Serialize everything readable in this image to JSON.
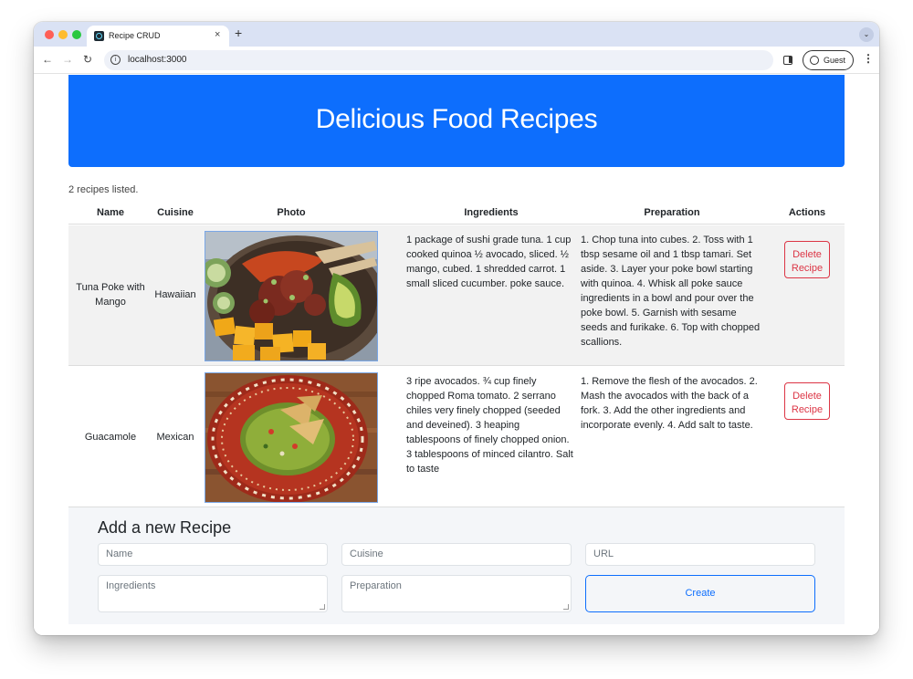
{
  "browser": {
    "tab_title": "Recipe CRUD",
    "tab_close": "×",
    "new_tab": "+",
    "tab_menu": "⌄",
    "url": "localhost:3000",
    "profile_label": "Guest"
  },
  "header": {
    "title": "Delicious Food Recipes"
  },
  "recipes_count_text": "2 recipes listed.",
  "table": {
    "columns": [
      "Name",
      "Cuisine",
      "Photo",
      "Ingredients",
      "Preparation",
      "Actions"
    ],
    "rows": [
      {
        "name": "Tuna Poke with Mango",
        "cuisine": "Hawaiian",
        "ingredients": "1 package of sushi grade tuna. 1 cup cooked quinoa ½ avocado, sliced. ½ mango, cubed. 1 shredded carrot. 1 small sliced cucumber. poke sauce.",
        "preparation": "1. Chop tuna into cubes. 2. Toss with 1 tbsp sesame oil and 1 tbsp tamari. Set aside. 3. Layer your poke bowl starting with quinoa. 4. Whisk all poke sauce ingredients in a bowl and pour over the poke bowl. 5. Garnish with sesame seeds and furikake. 6. Top with chopped scallions.",
        "action_label": "Delete Recipe"
      },
      {
        "name": "Guacamole",
        "cuisine": "Mexican",
        "ingredients": "3 ripe avocados. ¾ cup finely chopped Roma tomato. 2 serrano chiles very finely chopped (seeded and deveined). 3 heaping tablespoons of finely chopped onion. 3 tablespoons of minced cilantro. Salt to taste",
        "preparation": "1. Remove the flesh of the avocados. 2. Mash the avocados with the back of a fork. 3. Add the other ingredients and incorporate evenly. 4. Add salt to taste.",
        "action_label": "Delete Recipe"
      }
    ]
  },
  "form": {
    "title": "Add a new Recipe",
    "name_placeholder": "Name",
    "cuisine_placeholder": "Cuisine",
    "url_placeholder": "URL",
    "ingredients_placeholder": "Ingredients",
    "preparation_placeholder": "Preparation",
    "submit_label": "Create"
  },
  "colors": {
    "primary": "#0d6efd",
    "danger": "#dc3545",
    "tab_strip": "#dae2f4"
  }
}
